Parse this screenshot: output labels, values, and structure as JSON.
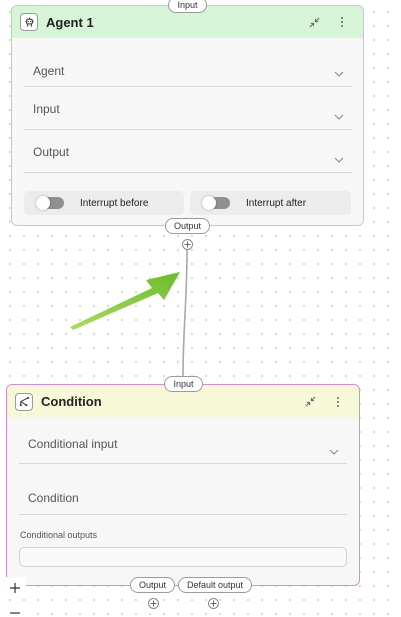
{
  "agent_node": {
    "title": "Agent 1",
    "icon": "robot-icon",
    "input_handle": "Input",
    "output_handle": "Output",
    "fields": {
      "agent": "Agent",
      "input": "Input",
      "output": "Output"
    },
    "toggles": {
      "interrupt_before": "Interrupt before",
      "interrupt_after": "Interrupt after"
    },
    "header_color": "#d6f5d6",
    "border_color": "#c9c9c9"
  },
  "condition_node": {
    "title": "Condition",
    "icon": "branch-icon",
    "input_handle": "Input",
    "output_handle": "Output",
    "default_output_handle": "Default output",
    "fields": {
      "conditional_input": "Conditional input",
      "condition": "Condition"
    },
    "conditional_outputs_label": "Conditional outputs",
    "header_color": "#f6f8d8",
    "border_color": "#d98be0"
  },
  "annotation": {
    "arrow_color": "#7cc63a"
  },
  "zoom": {
    "in_icon": "plus-icon",
    "out_icon": "minus-icon"
  }
}
